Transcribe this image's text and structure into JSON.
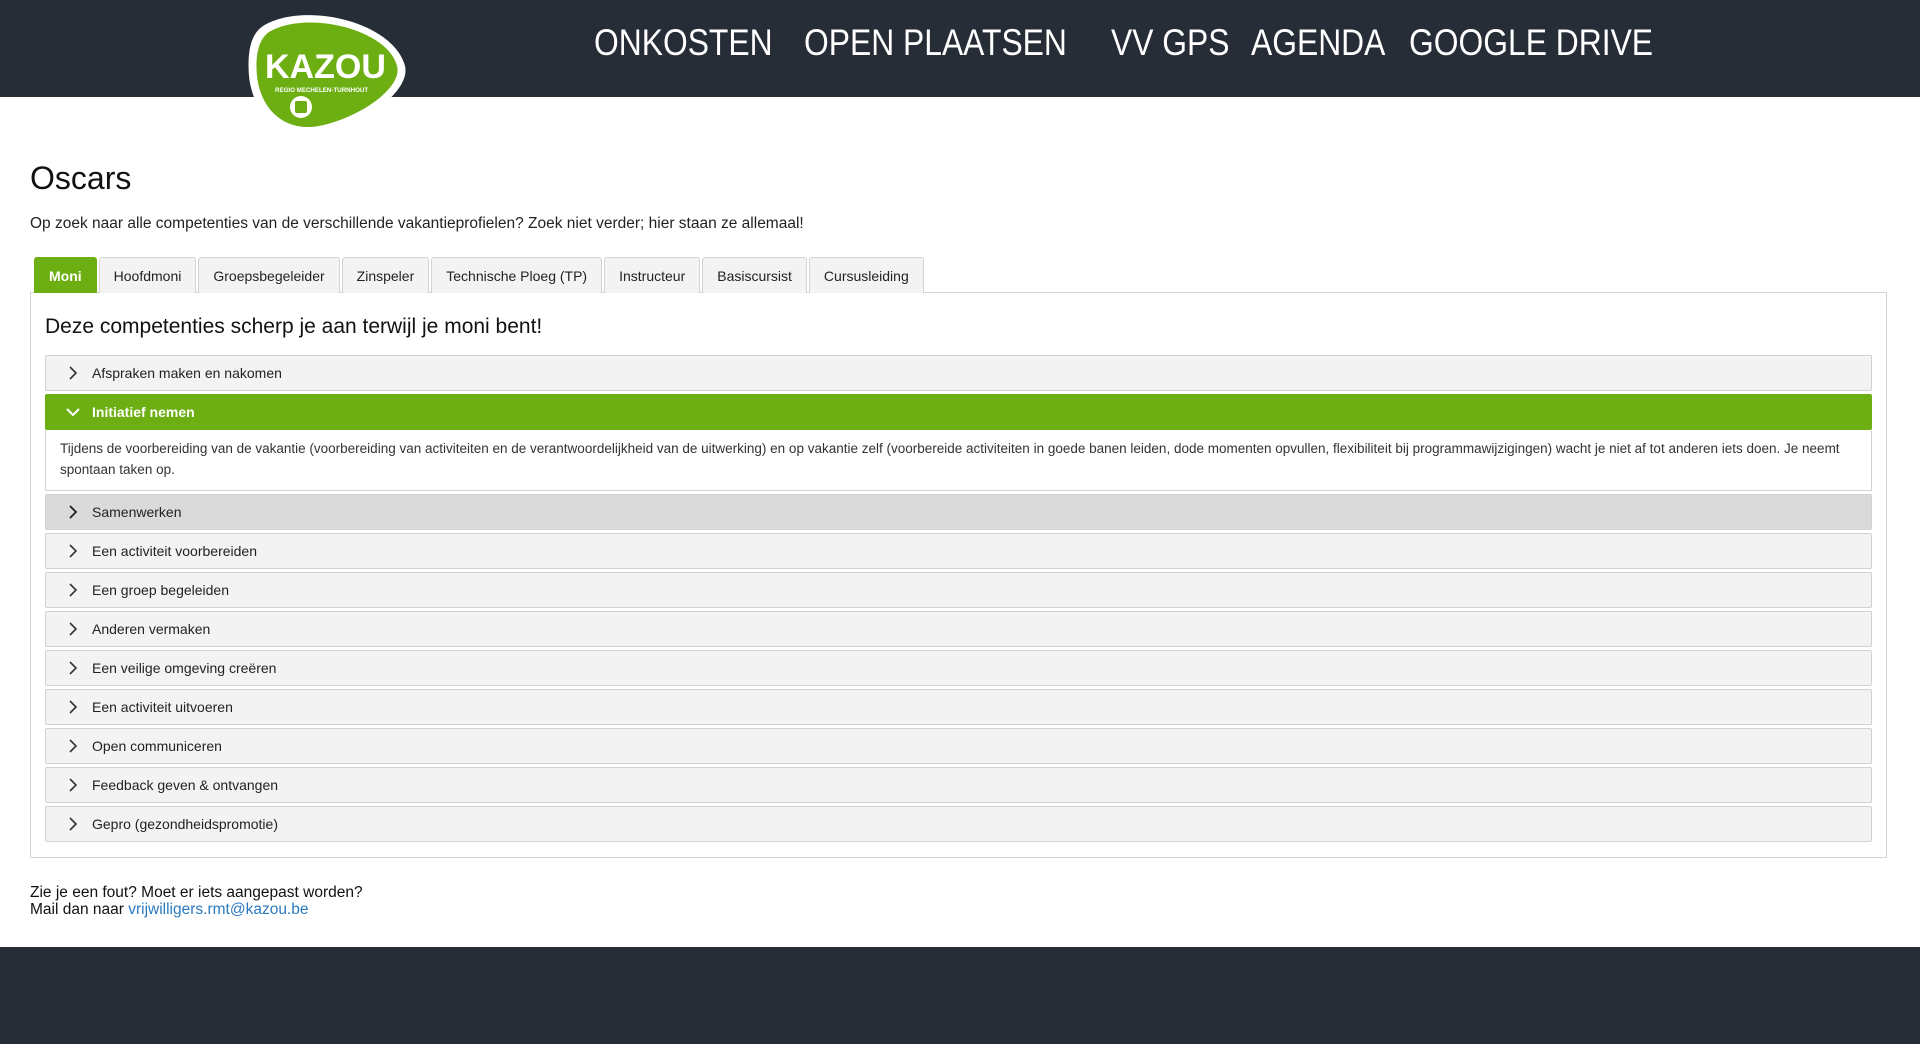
{
  "header": {
    "logo": {
      "text": "KAZOU",
      "subtext": "REGIO MECHELEN-TURNHOUT"
    },
    "nav": [
      "ONKOSTEN",
      "OPEN PLAATSEN",
      "VV GPS",
      "AGENDA",
      "GOOGLE DRIVE"
    ]
  },
  "page": {
    "title": "Oscars",
    "intro": "Op zoek naar alle competenties van de verschillende vakantieprofielen? Zoek niet verder; hier staan ze allemaal!"
  },
  "tabs": [
    "Moni",
    "Hoofdmoni",
    "Groepsbegeleider",
    "Zinspeler",
    "Technische Ploeg (TP)",
    "Instructeur",
    "Basiscursist",
    "Cursusleiding"
  ],
  "active_tab": "Moni",
  "panel": {
    "heading": "Deze competenties scherp je aan terwijl je moni bent!",
    "items": [
      {
        "label": "Afspraken maken en nakomen"
      },
      {
        "label": "Initiatief nemen",
        "body": "Tijdens de voorbereiding van de vakantie (voorbereiding van activiteiten en de verantwoordelijkheid van de uitwerking) en op vakantie zelf (voorbereide activiteiten in goede banen leiden, dode momenten opvullen, flexibiliteit bij programmawijzigingen) wacht je niet af tot anderen iets doen. Je neemt spontaan taken op."
      },
      {
        "label": "Samenwerken"
      },
      {
        "label": "Een activiteit voorbereiden"
      },
      {
        "label": "Een groep begeleiden"
      },
      {
        "label": "Anderen vermaken"
      },
      {
        "label": "Een veilige omgeving creëren"
      },
      {
        "label": "Een activiteit uitvoeren"
      },
      {
        "label": "Open communiceren"
      },
      {
        "label": "Feedback geven & ontvangen"
      },
      {
        "label": "Gepro (gezondheidspromotie)"
      }
    ]
  },
  "footer": {
    "line1": "Zie je een fout? Moet er iets aangepast worden?",
    "line2_prefix": "Mail dan naar ",
    "email": "vrijwilligers.rmt@kazou.be"
  },
  "colors": {
    "brand_green": "#6daf13",
    "dark": "#272d37",
    "link": "#2a7ac0"
  }
}
